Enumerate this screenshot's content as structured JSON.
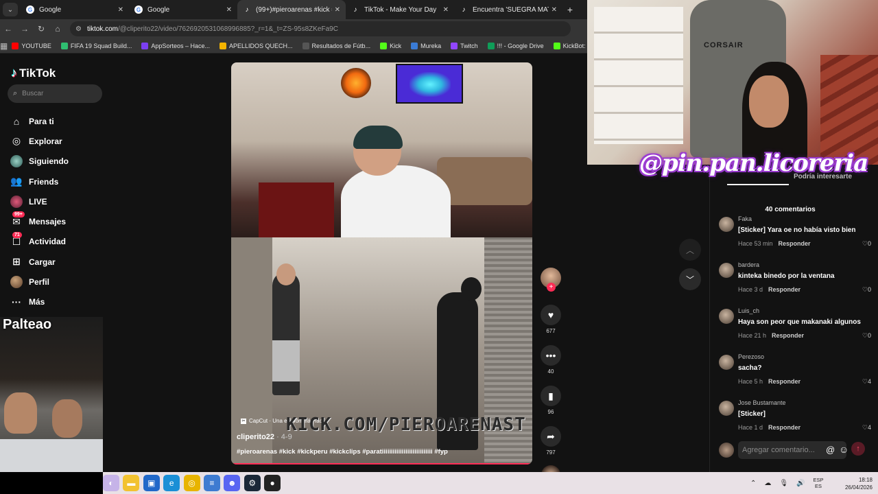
{
  "browser": {
    "tabs": [
      {
        "title": "Google",
        "favicon": "google-icon",
        "active": false
      },
      {
        "title": "Google",
        "favicon": "google-icon",
        "active": false
      },
      {
        "title": "(99+)#pieroarenas #kick #kickp",
        "favicon": "tiktok-icon",
        "active": true
      },
      {
        "title": "TikTok - Make Your Day",
        "favicon": "tiktok-icon",
        "active": false
      },
      {
        "title": "Encuentra 'SUEGRA MATA A SU",
        "favicon": "tiktok-icon",
        "active": false
      }
    ],
    "url_host": "tiktok.com",
    "url_path": "/@cliperito22/video/7626920531068996885?_r=1&_t=ZS-95s8ZKeFa9C",
    "bookmarks": [
      {
        "label": "YOUTUBE",
        "color": "#ff0000"
      },
      {
        "label": "FIFA 19 Squad Build...",
        "color": "#2fbf71"
      },
      {
        "label": "AppSorteos – Hace...",
        "color": "#7b3ff2"
      },
      {
        "label": "APELLIDOS QUECH...",
        "color": "#f4b400"
      },
      {
        "label": "Resultados de Fútb...",
        "color": "#555555"
      },
      {
        "label": "Kick",
        "color": "#53fc18"
      },
      {
        "label": "Mureka",
        "color": "#3a7bd5"
      },
      {
        "label": "Twitch",
        "color": "#9146ff"
      },
      {
        "label": "!!! - Google Drive",
        "color": "#0f9d58"
      },
      {
        "label": "KickBot: Customiza...",
        "color": "#53fc18"
      }
    ]
  },
  "tiktok": {
    "logo": "TikTok",
    "search_placeholder": "Buscar",
    "nav": [
      {
        "label": "Para ti",
        "icon": "home-icon",
        "name": "nav-para-ti"
      },
      {
        "label": "Explorar",
        "icon": "compass-icon",
        "name": "nav-explorar"
      },
      {
        "label": "Siguiendo",
        "icon": "following-icon",
        "name": "nav-siguiendo"
      },
      {
        "label": "Friends",
        "icon": "friends-icon",
        "name": "nav-friends"
      },
      {
        "label": "LIVE",
        "icon": "live-icon",
        "name": "nav-live"
      },
      {
        "label": "Mensajes",
        "icon": "messages-icon",
        "name": "nav-mensajes",
        "badge": "99+"
      },
      {
        "label": "Actividad",
        "icon": "activity-icon",
        "name": "nav-actividad",
        "badge": "71"
      },
      {
        "label": "Cargar",
        "icon": "upload-icon",
        "name": "nav-cargar"
      },
      {
        "label": "Perfil",
        "icon": "profile-icon",
        "name": "nav-perfil"
      },
      {
        "label": "Más",
        "icon": "more-icon",
        "name": "nav-mas"
      }
    ],
    "video": {
      "capcut_label": "CapCut · Una edición más fácil",
      "overlay_text": "KICK.COM/PIEROARENAST",
      "author": "cliperito22",
      "date": " · 4-9",
      "hashtags": "#pieroarenas #kick #kickperu #kickclips #paratiiiiiiiiiiiiiiiiiiiiiiiiiiii #fyp",
      "progress": 1.0
    },
    "actions": {
      "likes": "677",
      "comments": "40",
      "saves": "96",
      "shares": "797"
    },
    "comments_panel": {
      "tab_interest": "Podría interesarte",
      "count_label": "40 comentarios",
      "reply_label": "Responder",
      "input_placeholder": "Agregar comentario...",
      "items": [
        {
          "user": "Faka",
          "text": "[Sticker] Yara oe no había visto bien",
          "time": "Hace 53 min",
          "likes": "0"
        },
        {
          "user": "bardera",
          "text": "kinteka binedo por la ventana",
          "time": "Hace 3 d",
          "likes": "0"
        },
        {
          "user": "Luis_ch",
          "text": "Haya son peor que makanaki algunos",
          "time": "Hace 21 h",
          "likes": "0"
        },
        {
          "user": "Perezoso",
          "text": "sacha?",
          "time": "Hace 5 h",
          "likes": "4"
        },
        {
          "user": "Jose Bustamante",
          "text": "[Sticker]",
          "time": "Hace 1 d",
          "likes": "4"
        }
      ]
    }
  },
  "overlay": {
    "left_cam_label": "Palteao",
    "watermark": "@pin.pan.licoreria",
    "chair_brand": "CORSAIR"
  },
  "taskbar": {
    "lang_top": "ESP",
    "lang_bottom": "ES",
    "time": "18:18",
    "date": "26/04/2026"
  },
  "colors": {
    "accent": "#fe2c55",
    "watermark_glow": "#9b3cd1"
  }
}
